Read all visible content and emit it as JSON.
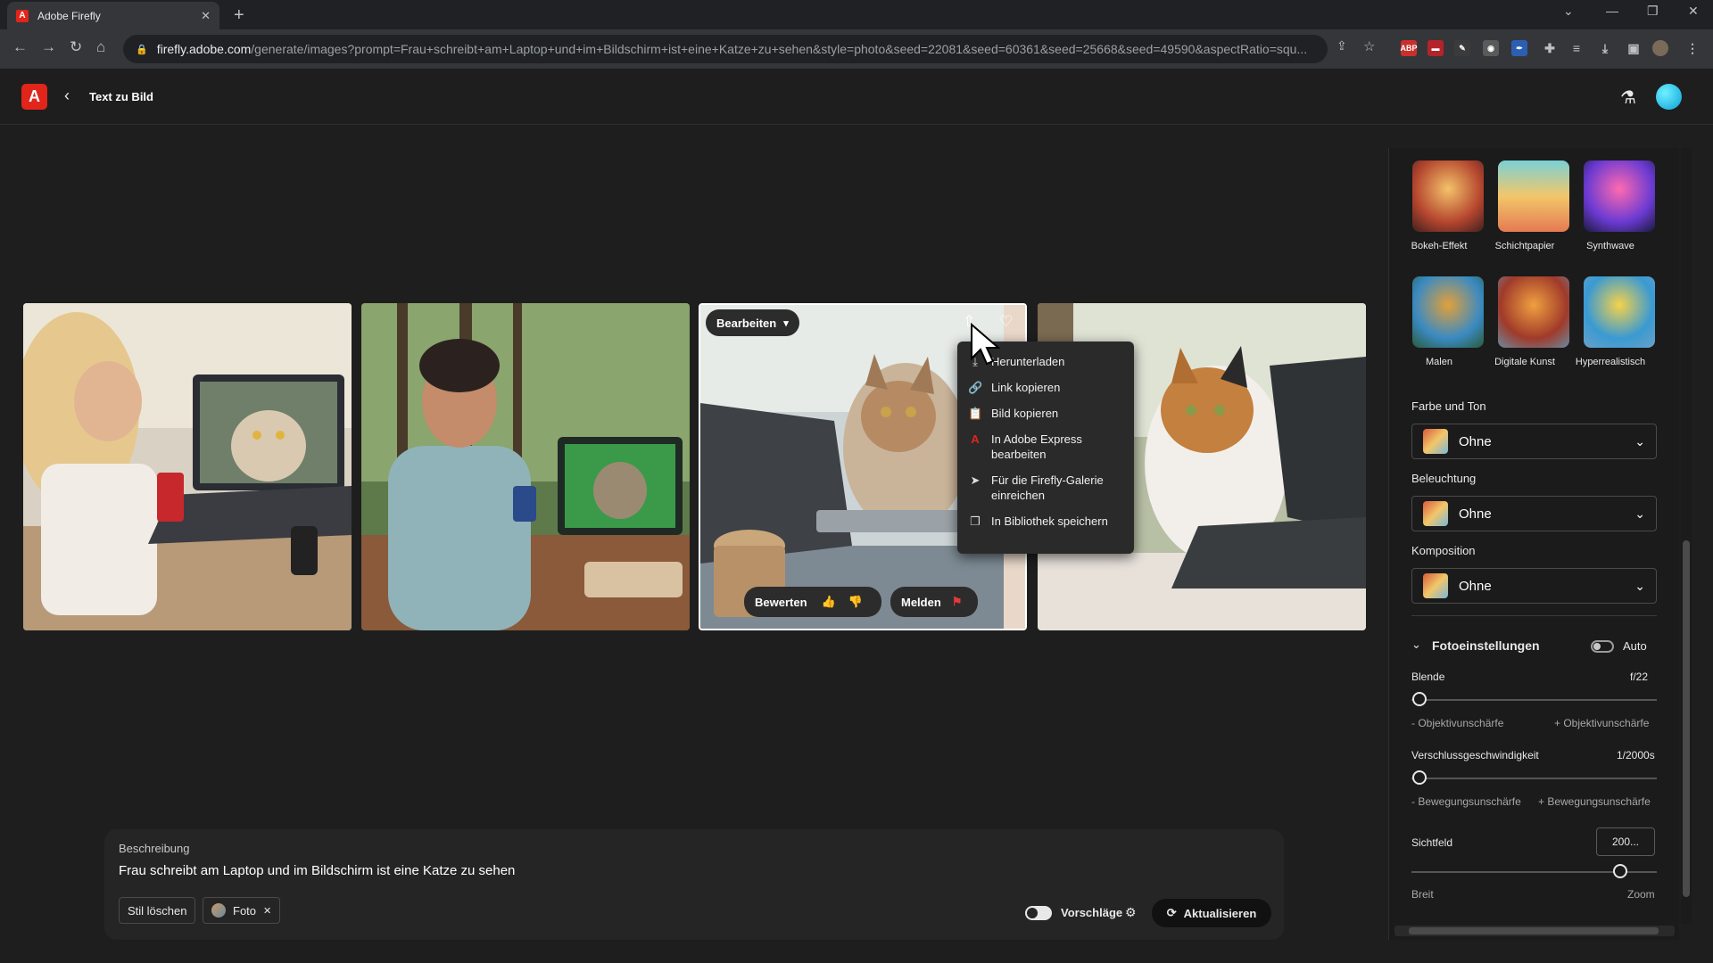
{
  "browser": {
    "tab_title": "Adobe Firefly",
    "url_domain": "firefly.adobe.com",
    "url_path": "/generate/images?prompt=Frau+schreibt+am+Laptop+und+im+Bildschirm+ist+eine+Katze+zu+sehen&style=photo&seed=22081&seed=60361&seed=25668&seed=49590&aspectRatio=squ..."
  },
  "header": {
    "title": "Text zu Bild"
  },
  "card_actions": {
    "edit_label": "Bearbeiten",
    "rate_label": "Bewerten",
    "report_label": "Melden"
  },
  "share_menu": {
    "items": [
      {
        "label": "Herunterladen",
        "icon": "download-icon"
      },
      {
        "label": "Link kopieren",
        "icon": "link-icon"
      },
      {
        "label": "Bild kopieren",
        "icon": "clipboard-icon"
      },
      {
        "label": "In Adobe Express bearbeiten",
        "icon": "adobe-express-icon"
      },
      {
        "label": "Für die Firefly-Galerie einreichen",
        "icon": "send-icon"
      },
      {
        "label": "In Bibliothek speichern",
        "icon": "library-icon"
      }
    ]
  },
  "prompt": {
    "label": "Beschreibung",
    "text": "Frau schreibt am Laptop und im Bildschirm ist eine Katze zu sehen",
    "clear_style": "Stil löschen",
    "style_chip": "Foto",
    "suggestions_label": "Vorschläge",
    "suggestions_on": true,
    "update_label": "Aktualisieren"
  },
  "panel": {
    "styles": [
      {
        "label": "Bokeh-Effekt"
      },
      {
        "label": "Schichtpapier"
      },
      {
        "label": "Synthwave"
      },
      {
        "label": "Malen"
      },
      {
        "label": "Digitale Kunst"
      },
      {
        "label": "Hyperrealistisch"
      }
    ],
    "color_tone_label": "Farbe und Ton",
    "color_tone_value": "Ohne",
    "lighting_label": "Beleuchtung",
    "lighting_value": "Ohne",
    "composition_label": "Komposition",
    "composition_value": "Ohne",
    "photo_settings_label": "Fotoeinstellungen",
    "auto_label": "Auto",
    "auto_on": false,
    "aperture_label": "Blende",
    "aperture_value": "f/22",
    "aperture_min": "- Objektivunschärfe",
    "aperture_max": "+ Objektivunschärfe",
    "shutter_label": "Verschlussgeschwindigkeit",
    "shutter_value": "1/2000s",
    "shutter_min": "- Bewegungsunschärfe",
    "shutter_max": "+ Bewegungsunschärfe",
    "fov_label": "Sichtfeld",
    "fov_value": "200...",
    "fov_min": "Breit",
    "fov_max": "Zoom"
  }
}
